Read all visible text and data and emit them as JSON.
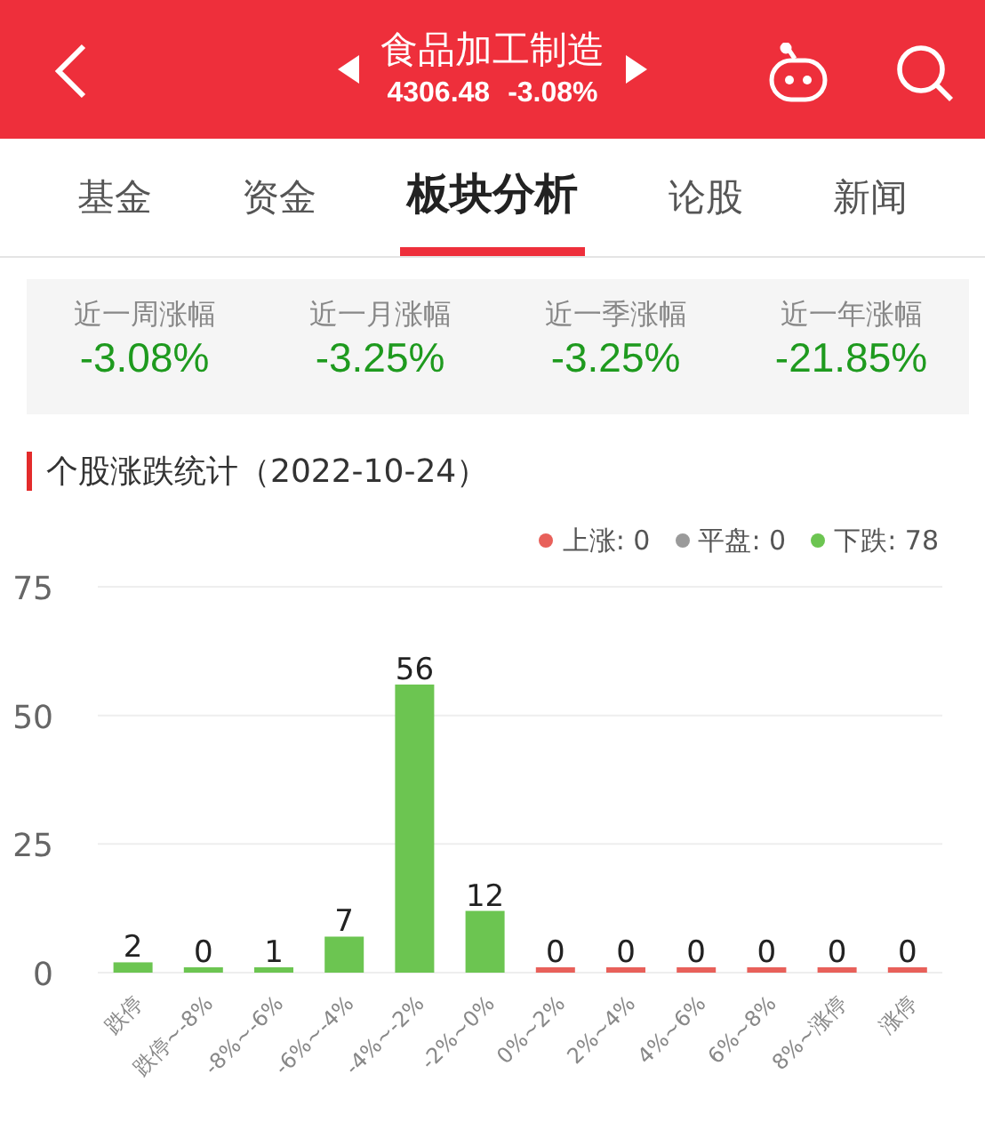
{
  "header": {
    "title": "食品加工制造",
    "price": "4306.48",
    "change": "-3.08%"
  },
  "tabs": [
    {
      "label": "基金",
      "selected": false
    },
    {
      "label": "资金",
      "selected": false
    },
    {
      "label": "板块分析",
      "selected": true
    },
    {
      "label": "论股",
      "selected": false
    },
    {
      "label": "新闻",
      "selected": false
    }
  ],
  "stats": [
    {
      "label": "近一周涨幅",
      "value": "-3.08%"
    },
    {
      "label": "近一月涨幅",
      "value": "-3.25%"
    },
    {
      "label": "近一季涨幅",
      "value": "-3.25%"
    },
    {
      "label": "近一年涨幅",
      "value": "-21.85%"
    }
  ],
  "section_title": "个股涨跌统计（2022-10-24）",
  "legend": [
    {
      "label": "上涨: 0",
      "color": "#e8605a"
    },
    {
      "label": "平盘: 0",
      "color": "#9a9a9a"
    },
    {
      "label": "下跌: 78",
      "color": "#6cc551"
    }
  ],
  "chart_data": {
    "type": "bar",
    "categories": [
      "跌停",
      "跌停~-8%",
      "-8%~-6%",
      "-6%~-4%",
      "-4%~-2%",
      "-2%~0%",
      "0%~2%",
      "2%~4%",
      "4%~6%",
      "6%~8%",
      "8%~涨停",
      "涨停"
    ],
    "series": [
      {
        "color": "#6cc551",
        "values": [
          2,
          0,
          1,
          7,
          56,
          12,
          null,
          null,
          null,
          null,
          null,
          null
        ]
      },
      {
        "color": "#e8605a",
        "values": [
          null,
          null,
          null,
          null,
          null,
          null,
          0,
          0,
          0,
          0,
          0,
          0
        ]
      }
    ],
    "ylim": [
      0,
      75
    ],
    "yticks": [
      0,
      25,
      50,
      75
    ],
    "data_labels": true
  }
}
